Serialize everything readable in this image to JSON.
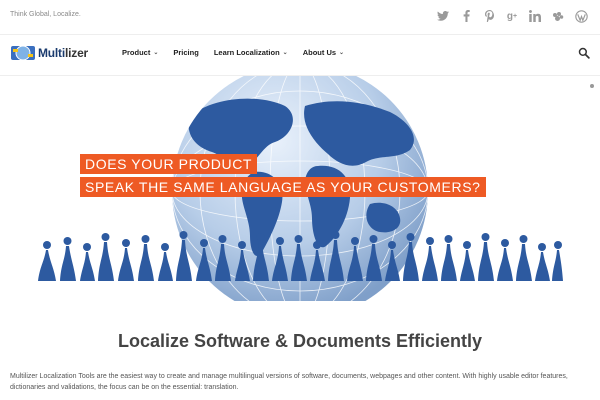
{
  "topbar": {
    "tagline": "Think Global, Localize.",
    "social_icons": [
      "twitter-icon",
      "facebook-icon",
      "pinterest-icon",
      "google-plus-icon",
      "linkedin-icon",
      "meetup-icon",
      "wordpress-icon"
    ]
  },
  "logo": {
    "text_main": "Multi",
    "text_accent": "lizer"
  },
  "nav": {
    "items": [
      {
        "label": "Product",
        "has_dropdown": true
      },
      {
        "label": "Pricing",
        "has_dropdown": false
      },
      {
        "label": "Learn Localization",
        "has_dropdown": true
      },
      {
        "label": "About Us",
        "has_dropdown": true
      }
    ]
  },
  "hero": {
    "line1": "DOES YOUR PRODUCT",
    "line2": "SPEAK THE SAME LANGUAGE AS YOUR CUSTOMERS?",
    "accent_color": "#ee5a24",
    "globe_color": "#2d5aa0"
  },
  "main": {
    "headline": "Localize Software & Documents Efficiently",
    "intro": "Multilizer Localization Tools are the easiest way to create and manage multilingual versions of software, documents, webpages and other content. With highly usable editor features, dictionaries and validations, the focus can be on the essential: translation."
  }
}
